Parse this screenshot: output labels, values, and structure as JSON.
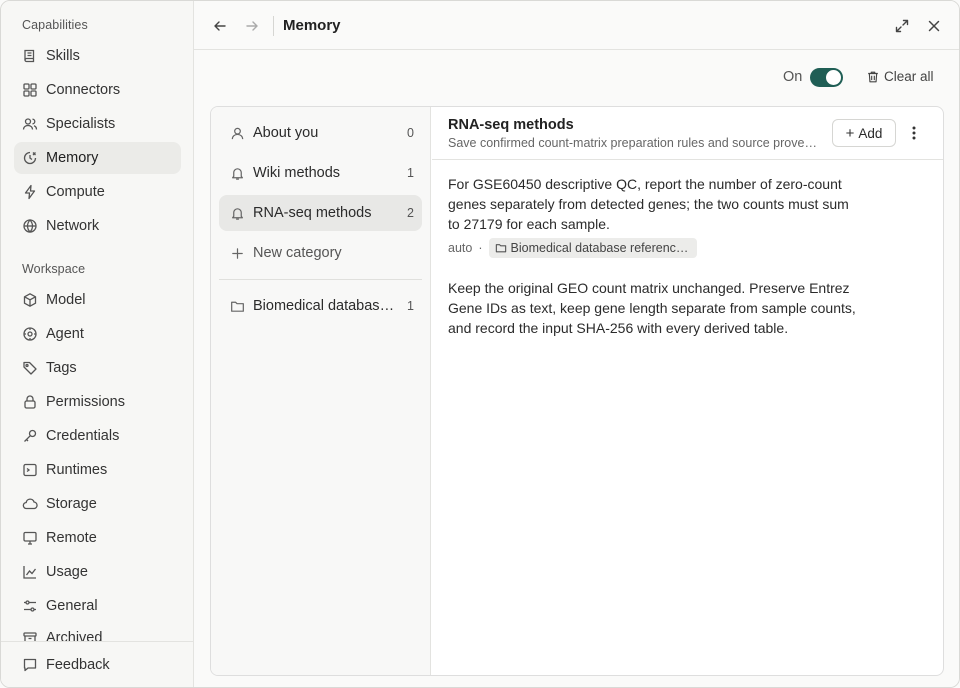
{
  "sidebar": {
    "capabilities_label": "Capabilities",
    "capabilities": [
      {
        "label": "Skills",
        "icon": "book-icon"
      },
      {
        "label": "Connectors",
        "icon": "grid-icon"
      },
      {
        "label": "Specialists",
        "icon": "users-icon"
      },
      {
        "label": "Memory",
        "icon": "memory-icon"
      },
      {
        "label": "Compute",
        "icon": "lightning-icon"
      },
      {
        "label": "Network",
        "icon": "globe-icon"
      }
    ],
    "workspace_label": "Workspace",
    "workspace": [
      {
        "label": "Model",
        "icon": "cube-icon"
      },
      {
        "label": "Agent",
        "icon": "agent-icon"
      },
      {
        "label": "Tags",
        "icon": "tag-icon"
      },
      {
        "label": "Permissions",
        "icon": "lock-icon"
      },
      {
        "label": "Credentials",
        "icon": "key-icon"
      },
      {
        "label": "Runtimes",
        "icon": "terminal-icon"
      },
      {
        "label": "Storage",
        "icon": "cloud-icon"
      },
      {
        "label": "Remote",
        "icon": "monitor-icon"
      },
      {
        "label": "Usage",
        "icon": "chart-icon"
      },
      {
        "label": "General",
        "icon": "sliders-icon"
      },
      {
        "label": "Archived",
        "icon": "archive-icon"
      }
    ],
    "footer": {
      "label": "Feedback",
      "icon": "message-icon"
    }
  },
  "header": {
    "title": "Memory"
  },
  "toolbar": {
    "on_label": "On",
    "enabled": true,
    "clear_all_label": "Clear all"
  },
  "categories": [
    {
      "label": "About you",
      "count": "0",
      "icon": "person-icon"
    },
    {
      "label": "Wiki methods",
      "count": "1",
      "icon": "bell-icon"
    },
    {
      "label": "RNA-seq methods",
      "count": "2",
      "icon": "bell-icon",
      "active": true
    },
    {
      "label": "New category",
      "icon": "plus-icon"
    },
    {
      "label": "Biomedical database references",
      "count": "1",
      "icon": "folder-icon"
    }
  ],
  "detail": {
    "title": "RNA-seq methods",
    "subtitle": "Save confirmed count-matrix preparation rules and source provenance",
    "add_label": "Add",
    "memories": [
      {
        "text": "For GSE60450 descriptive QC, report the number of zero-count genes separately from detected genes; the two counts must sum to 27179 for each sample.",
        "source": "auto",
        "tag": "Biomedical database references"
      },
      {
        "text": "Keep the original GEO count matrix unchanged. Preserve Entrez Gene IDs as text, keep gene length separate from sample counts, and record the input SHA-256 with every derived table."
      }
    ]
  },
  "colors": {
    "accent": "#1f5e55",
    "active_bg": "#ebebe8"
  }
}
